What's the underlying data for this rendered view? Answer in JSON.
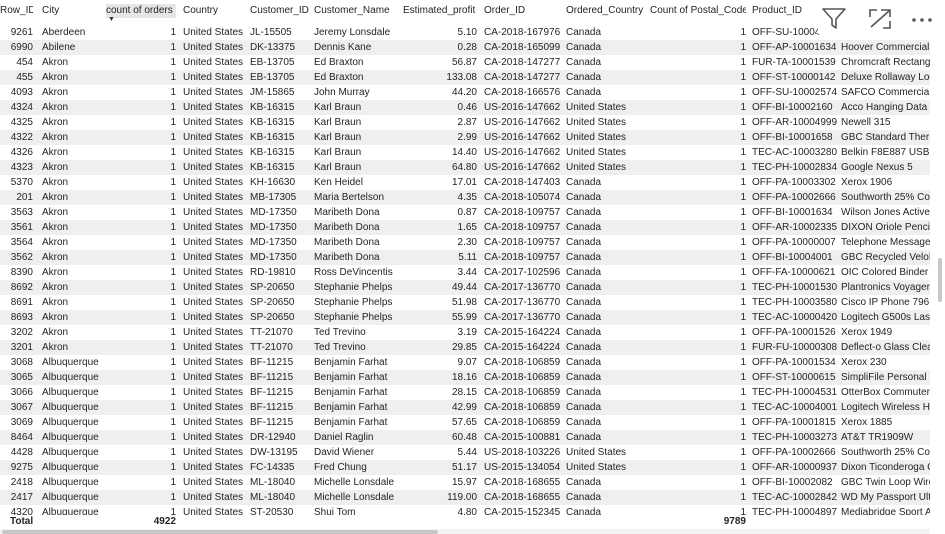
{
  "columns": [
    {
      "label": "Row_ID",
      "sorted": false
    },
    {
      "label": "City",
      "sorted": false
    },
    {
      "label": "count of orders",
      "sorted": true
    },
    {
      "label": "Country",
      "sorted": false
    },
    {
      "label": "Customer_ID",
      "sorted": false
    },
    {
      "label": "Customer_Name",
      "sorted": false
    },
    {
      "label": "Estimated_profit",
      "sorted": false
    },
    {
      "label": "Order_ID",
      "sorted": false
    },
    {
      "label": "Ordered_Country",
      "sorted": false
    },
    {
      "label": "Count of Postal_Code",
      "sorted": false
    },
    {
      "label": "Product_ID",
      "sorted": false
    },
    {
      "label": "Product_Name",
      "sorted": false
    }
  ],
  "rows": [
    [
      "9261",
      "Aberdeen",
      "1",
      "United States",
      "JL-15505",
      "Jeremy Lonsdale",
      "5.10",
      "CA-2018-167976",
      "Canada",
      "1",
      "OFF-SU-10004",
      ""
    ],
    [
      "6990",
      "Abilene",
      "1",
      "United States",
      "DK-13375",
      "Dennis Kane",
      "0.28",
      "CA-2018-165099",
      "Canada",
      "1",
      "OFF-AP-10001634",
      "Hoover Commercial"
    ],
    [
      "454",
      "Akron",
      "1",
      "United States",
      "EB-13705",
      "Ed Braxton",
      "56.87",
      "CA-2018-147277",
      "Canada",
      "1",
      "FUR-TA-10001539",
      "Chromcraft Rectangu"
    ],
    [
      "455",
      "Akron",
      "1",
      "United States",
      "EB-13705",
      "Ed Braxton",
      "133.08",
      "CA-2018-147277",
      "Canada",
      "1",
      "OFF-ST-10000142",
      "Deluxe Rollaway Lock"
    ],
    [
      "4093",
      "Akron",
      "1",
      "United States",
      "JM-15865",
      "John Murray",
      "44.20",
      "CA-2018-166576",
      "Canada",
      "1",
      "OFF-SU-10002574",
      "SAFCO Commercial W"
    ],
    [
      "4324",
      "Akron",
      "1",
      "United States",
      "KB-16315",
      "Karl Braun",
      "0.46",
      "US-2016-147662",
      "United States",
      "1",
      "OFF-BI-10002160",
      "Acco Hanging Data B"
    ],
    [
      "4325",
      "Akron",
      "1",
      "United States",
      "KB-16315",
      "Karl Braun",
      "2.87",
      "US-2016-147662",
      "United States",
      "1",
      "OFF-AR-10004999",
      "Newell 315"
    ],
    [
      "4322",
      "Akron",
      "1",
      "United States",
      "KB-16315",
      "Karl Braun",
      "2.99",
      "US-2016-147662",
      "United States",
      "1",
      "OFF-BI-10001658",
      "GBC Standard Therm"
    ],
    [
      "4326",
      "Akron",
      "1",
      "United States",
      "KB-16315",
      "Karl Braun",
      "14.40",
      "US-2016-147662",
      "United States",
      "1",
      "TEC-AC-10003280",
      "Belkin F8E887 USB W"
    ],
    [
      "4323",
      "Akron",
      "1",
      "United States",
      "KB-16315",
      "Karl Braun",
      "64.80",
      "US-2016-147662",
      "United States",
      "1",
      "TEC-PH-10002834",
      "Google Nexus 5"
    ],
    [
      "5370",
      "Akron",
      "1",
      "United States",
      "KH-16630",
      "Ken Heidel",
      "17.01",
      "CA-2018-147403",
      "Canada",
      "1",
      "OFF-PA-10003302",
      "Xerox 1906"
    ],
    [
      "201",
      "Akron",
      "1",
      "United States",
      "MB-17305",
      "Maria Bertelson",
      "4.35",
      "CA-2018-105074",
      "Canada",
      "1",
      "OFF-PA-10002666",
      "Southworth 25% Cot"
    ],
    [
      "3563",
      "Akron",
      "1",
      "United States",
      "MD-17350",
      "Maribeth Dona",
      "0.87",
      "CA-2018-109757",
      "Canada",
      "1",
      "OFF-BI-10001634",
      "Wilson Jones Active"
    ],
    [
      "3561",
      "Akron",
      "1",
      "United States",
      "MD-17350",
      "Maribeth Dona",
      "1.65",
      "CA-2018-109757",
      "Canada",
      "1",
      "OFF-AR-10002335",
      "DIXON Oriole Pencils"
    ],
    [
      "3564",
      "Akron",
      "1",
      "United States",
      "MD-17350",
      "Maribeth Dona",
      "2.30",
      "CA-2018-109757",
      "Canada",
      "1",
      "OFF-PA-10000007",
      "Telephone Message B"
    ],
    [
      "3562",
      "Akron",
      "1",
      "United States",
      "MD-17350",
      "Maribeth Dona",
      "5.11",
      "CA-2018-109757",
      "Canada",
      "1",
      "OFF-BI-10004001",
      "GBC Recycled VeloBi"
    ],
    [
      "8390",
      "Akron",
      "1",
      "United States",
      "RD-19810",
      "Ross DeVincentis",
      "3.44",
      "CA-2017-102596",
      "Canada",
      "1",
      "OFF-FA-10000621",
      "OIC Colored Binder C"
    ],
    [
      "8692",
      "Akron",
      "1",
      "United States",
      "SP-20650",
      "Stephanie Phelps",
      "49.44",
      "CA-2017-136770",
      "Canada",
      "1",
      "TEC-PH-10001530",
      "Plantronics Voyager B"
    ],
    [
      "8691",
      "Akron",
      "1",
      "United States",
      "SP-20650",
      "Stephanie Phelps",
      "51.98",
      "CA-2017-136770",
      "Canada",
      "1",
      "TEC-PH-10003580",
      "Cisco IP Phone 7961G"
    ],
    [
      "8693",
      "Akron",
      "1",
      "United States",
      "SP-20650",
      "Stephanie Phelps",
      "55.99",
      "CA-2017-136770",
      "Canada",
      "1",
      "TEC-AC-10000420",
      "Logitech G500s Laser"
    ],
    [
      "3202",
      "Akron",
      "1",
      "United States",
      "TT-21070",
      "Ted Trevino",
      "3.19",
      "CA-2015-164224",
      "Canada",
      "1",
      "OFF-PA-10001526",
      "Xerox 1949"
    ],
    [
      "3201",
      "Akron",
      "1",
      "United States",
      "TT-21070",
      "Ted Trevino",
      "29.85",
      "CA-2015-164224",
      "Canada",
      "1",
      "FUR-FU-10000308",
      "Deflect-o Glass Clear"
    ],
    [
      "3068",
      "Albuquerque",
      "1",
      "United States",
      "BF-11215",
      "Benjamin Farhat",
      "9.07",
      "CA-2018-106859",
      "Canada",
      "1",
      "OFF-PA-10001534",
      "Xerox 230"
    ],
    [
      "3065",
      "Albuquerque",
      "1",
      "United States",
      "BF-11215",
      "Benjamin Farhat",
      "18.16",
      "CA-2018-106859",
      "Canada",
      "1",
      "OFF-ST-10000615",
      "SimpliFile Personal Fi"
    ],
    [
      "3066",
      "Albuquerque",
      "1",
      "United States",
      "BF-11215",
      "Benjamin Farhat",
      "28.15",
      "CA-2018-106859",
      "Canada",
      "1",
      "TEC-PH-10004531",
      "OtterBox Commuter"
    ],
    [
      "3067",
      "Albuquerque",
      "1",
      "United States",
      "BF-11215",
      "Benjamin Farhat",
      "42.99",
      "CA-2018-106859",
      "Canada",
      "1",
      "TEC-AC-10004001",
      "Logitech Wireless He"
    ],
    [
      "3069",
      "Albuquerque",
      "1",
      "United States",
      "BF-11215",
      "Benjamin Farhat",
      "57.65",
      "CA-2018-106859",
      "Canada",
      "1",
      "OFF-PA-10001815",
      "Xerox 1885"
    ],
    [
      "8464",
      "Albuquerque",
      "1",
      "United States",
      "DR-12940",
      "Daniel Raglin",
      "60.48",
      "CA-2015-100881",
      "Canada",
      "1",
      "TEC-PH-10003273",
      "AT&T TR1909W"
    ],
    [
      "4428",
      "Albuquerque",
      "1",
      "United States",
      "DW-13195",
      "David Wiener",
      "5.44",
      "US-2018-103226",
      "United States",
      "1",
      "OFF-PA-10002666",
      "Southworth 25% Cott"
    ],
    [
      "9275",
      "Albuquerque",
      "1",
      "United States",
      "FC-14335",
      "Fred Chung",
      "51.17",
      "US-2015-134054",
      "United States",
      "1",
      "OFF-AR-10000937",
      "Dixon Ticonderoga C"
    ],
    [
      "2418",
      "Albuquerque",
      "1",
      "United States",
      "ML-18040",
      "Michelle Lonsdale",
      "15.97",
      "CA-2018-168655",
      "Canada",
      "1",
      "OFF-BI-10002082",
      "GBC Twin Loop Wire"
    ],
    [
      "2417",
      "Albuquerque",
      "1",
      "United States",
      "ML-18040",
      "Michelle Lonsdale",
      "119.00",
      "CA-2018-168655",
      "Canada",
      "1",
      "TEC-AC-10002842",
      "WD My Passport Ultr"
    ],
    [
      "4320",
      "Albuquerque",
      "1",
      "United States",
      "ST-20530",
      "Shui Tom",
      "4.80",
      "CA-2015-152345",
      "Canada",
      "1",
      "TEC-PH-10004897",
      "Mediabridge Sport A"
    ]
  ],
  "total": {
    "label": "Total",
    "count_of_orders": "4922",
    "count_of_postal_code": "9789"
  },
  "header_icons": [
    "filter-icon",
    "focus-mode-icon",
    "more-options-icon"
  ]
}
